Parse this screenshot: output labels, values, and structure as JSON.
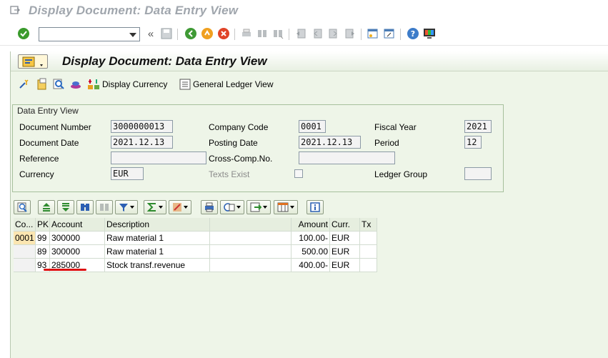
{
  "window": {
    "title": "Display Document: Data Entry View"
  },
  "toolbar": {
    "command_field_value": ""
  },
  "screen": {
    "title": "Display Document: Data Entry View",
    "app_buttons": [
      {
        "icon": "select-icon",
        "label": ""
      },
      {
        "icon": "document-icon",
        "label": ""
      },
      {
        "icon": "search-icon",
        "label": ""
      },
      {
        "icon": "tax-icon",
        "label": ""
      },
      {
        "icon": "currency-icon",
        "label": "Display Currency"
      },
      {
        "icon": "ledger-icon",
        "label": "General Ledger View"
      }
    ]
  },
  "data_entry": {
    "group_title": "Data Entry View",
    "document_number": {
      "label": "Document Number",
      "value": "3000000013"
    },
    "company_code": {
      "label": "Company Code",
      "value": "0001"
    },
    "fiscal_year": {
      "label": "Fiscal Year",
      "value": "2021"
    },
    "document_date": {
      "label": "Document Date",
      "value": "2021.12.13"
    },
    "posting_date": {
      "label": "Posting Date",
      "value": "2021.12.13"
    },
    "period": {
      "label": "Period",
      "value": "12"
    },
    "reference": {
      "label": "Reference",
      "value": ""
    },
    "cross_comp": {
      "label": "Cross-Comp.No.",
      "value": ""
    },
    "currency": {
      "label": "Currency",
      "value": "EUR"
    },
    "texts_exist": {
      "label": "Texts Exist",
      "checked": false
    },
    "ledger_group": {
      "label": "Ledger Group",
      "value": ""
    }
  },
  "grid": {
    "headers": [
      "Co...",
      "PK",
      "Account",
      "Description",
      "",
      "Amount",
      "Curr.",
      "Tx"
    ],
    "rows": [
      {
        "co": "0001",
        "pk": "99",
        "account": "300000",
        "description": "Raw material 1",
        "amount": "100.00-",
        "curr": "EUR",
        "tx": ""
      },
      {
        "co": "",
        "pk": "89",
        "account": "300000",
        "description": "Raw material 1",
        "amount": "500.00",
        "curr": "EUR",
        "tx": ""
      },
      {
        "co": "",
        "pk": "93",
        "account": "285000",
        "description": "Stock transf.revenue",
        "amount": "400.00-",
        "curr": "EUR",
        "tx": ""
      }
    ]
  },
  "colors": {
    "background": "#eef5e8",
    "title_grey": "#a0a6ad",
    "highlight_key": "#fbe6b1",
    "annotation_red": "#d11111"
  }
}
